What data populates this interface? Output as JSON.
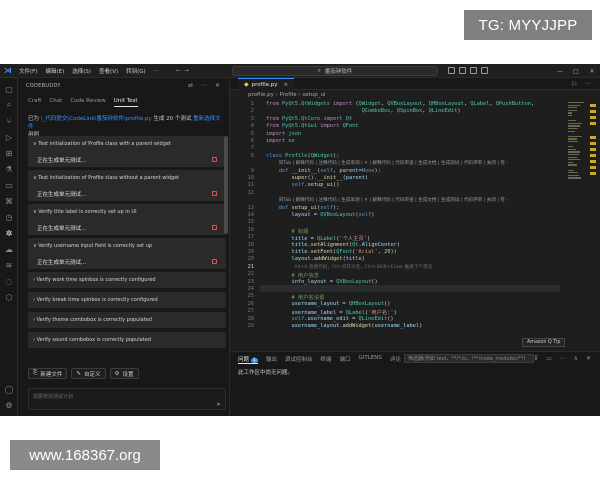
{
  "watermarks": {
    "top_right": "TG: MYYJJPP",
    "bottom_left": "www.168367.org"
  },
  "titlebar": {
    "logo": "⋊",
    "menu": [
      "文件(F)",
      "编辑(E)",
      "选择(S)",
      "查看(V)",
      "转到(G)",
      "…"
    ],
    "search_text": "番茄钟软件",
    "window_controls": [
      "—",
      "□",
      "✕"
    ]
  },
  "sidebar": {
    "header": "CODEBUDDY",
    "header_icons": "⇄ ⋯ ✕",
    "tabs": [
      "Craft",
      "Chat",
      "Code Review",
      "Unit Test"
    ],
    "info": {
      "prefix": "已为 ",
      "path": "\\_代码提交\\CodeLink\\番茄钟软件\\profile.py",
      "middle": " 生成 20 个测试 ",
      "retry": "重新选择文件",
      "suffix": "用例"
    },
    "tests": [
      {
        "title": "Test initialization of Profile class with a parent widget",
        "status": "正在生成单元测试..."
      },
      {
        "title": "Test initialization of Profile class without a parent widget",
        "status": "正在生成单元测试..."
      },
      {
        "title": "Verify title label is correctly set up in UI",
        "status": "正在生成单元测试..."
      },
      {
        "title": "Verify username input field is correctly set up",
        "status": "正在生成单元测试..."
      },
      {
        "title": "Verify work time spinbox is correctly configured"
      },
      {
        "title": "Verify break time spinbox is correctly configured"
      },
      {
        "title": "Verify theme combobox is correctly populated"
      },
      {
        "title": "Verify sound combobox is correctly populated"
      }
    ],
    "actions": [
      "新建文件",
      "自定义",
      "设置"
    ],
    "input_placeholder": "需要修改测试计划",
    "send_icon": "➤"
  },
  "editor": {
    "tab_label": "profile.py",
    "tab_close": "×",
    "tab_tools": "▷ ⋯",
    "breadcrumb": "profile.py  ›  Profile  ›  setup_ui",
    "tooltip": "Amazon Q Tip",
    "lines": [
      {
        "n": "1",
        "html": "<span class=\"kf\">from</span> <span class=\"cls\">PyQt5.QtWidgets</span> <span class=\"kf\">import</span> (<span class=\"cls\">QWidget</span>, <span class=\"cls\">QVBoxLayout</span>, <span class=\"cls\">QHBoxLayout</span>, <span class=\"cls\">QLabel</span>, <span class=\"cls\">QPushButton</span>,"
      },
      {
        "n": "2",
        "html": "                              <span class=\"cls\">QComboBox</span>, <span class=\"cls\">QSpinBox</span>, <span class=\"cls\">QLineEdit</span>)"
      },
      {
        "n": "3",
        "html": "<span class=\"kf\">from</span> <span class=\"cls\">PyQt5.QtCore</span> <span class=\"kf\">import</span> <span class=\"cls\">Qt</span>"
      },
      {
        "n": "4",
        "html": "<span class=\"kf\">from</span> <span class=\"cls\">PyQt5.QtGui</span> <span class=\"kf\">import</span> <span class=\"cls\">QFont</span>"
      },
      {
        "n": "5",
        "html": "<span class=\"kf\">import</span> <span class=\"cls\">json</span>"
      },
      {
        "n": "6",
        "html": "<span class=\"kf\">import</span> <span class=\"cls\">os</span>"
      },
      {
        "n": "7",
        "html": ""
      },
      {
        "n": "8",
        "html": "<span class=\"k\">class</span> <span class=\"cls\">Profile</span>(<span class=\"cls\">QWidget</span>):"
      },
      {
        "n": "",
        "html": "    <span class=\"codelens\">同Tab | 解释代码 | 注释代码 | 生成单测 | ✕ | 解释代码 | 代码审查 | 生成文档 | 生成测试 | 代码评审 | 关闭 | 有 -</span>"
      },
      {
        "n": "9",
        "html": "    <span class=\"k\">def</span> <span class=\"fn\">__init__</span>(<span class=\"self\">self</span>, <span class=\"var\">parent</span>=<span class=\"k\">None</span>):"
      },
      {
        "n": "10",
        "html": "        <span class=\"fn\">super</span>().<span class=\"fn\">__init__</span>(<span class=\"var\">parent</span>)"
      },
      {
        "n": "11",
        "html": "        <span class=\"self\">self</span>.<span class=\"fn\">setup_ui</span>()"
      },
      {
        "n": "12",
        "html": ""
      },
      {
        "n": "",
        "html": "    <span class=\"codelens\">同Tab | 解释代码 | 注释代码 | 生成单测 | ✕ | 解释代码 | 代码审查 | 生成文档 | 生成测试 | 代码评审 | 关闭 | 有 -</span>"
      },
      {
        "n": "13",
        "html": "    <span class=\"k\">def</span> <span class=\"fn\">setup_ui</span>(<span class=\"self\">self</span>):"
      },
      {
        "n": "14",
        "html": "        <span class=\"var\">layout</span> = <span class=\"cls\">QVBoxLayout</span>(<span class=\"self\">self</span>)"
      },
      {
        "n": "15",
        "html": ""
      },
      {
        "n": "16",
        "html": "        <span class=\"cm\"># 标题</span>"
      },
      {
        "n": "17",
        "html": "        <span class=\"var\">title</span> = <span class=\"cls\">QLabel</span>(<span class=\"str\">'个人主页'</span>)"
      },
      {
        "n": "18",
        "html": "        <span class=\"var\">title</span>.<span class=\"fn\">setAlignment</span>(<span class=\"cls\">Qt</span>.<span class=\"var\">AlignCenter</span>)"
      },
      {
        "n": "19",
        "html": "        <span class=\"var\">title</span>.<span class=\"fn\">setFont</span>(<span class=\"cls\">QFont</span>(<span class=\"str\">'Arial'</span>, <span class=\"num\">20</span>))"
      },
      {
        "n": "20",
        "html": "        <span class=\"var\">layout</span>.<span class=\"fn\">addWidget</span>(<span class=\"var\">title</span>)"
      },
      {
        "n": "21",
        "html": "        <span class=\"ghost\">  Alt+K 快捷代码，Ctrl 点开对话，Ctrl+Shift+Enter 触发下个建议</span>"
      },
      {
        "n": "22",
        "html": "        <span class=\"cm\"># 用户信息</span>"
      },
      {
        "n": "23",
        "html": "        <span class=\"var\">info_layout</span> = <span class=\"cls\">QVBoxLayout</span>()"
      },
      {
        "n": "24",
        "html": ""
      },
      {
        "n": "25",
        "html": "        <span class=\"cm\"># 用户名设置</span>"
      },
      {
        "n": "26",
        "html": "        <span class=\"var\">username_layout</span> = <span class=\"cls\">QHBoxLayout</span>()"
      },
      {
        "n": "27",
        "html": "        <span class=\"var\">username_label</span> = <span class=\"cls\">QLabel</span>(<span class=\"str\">'用户名:'</span>)"
      },
      {
        "n": "28",
        "html": "        <span class=\"self\">self</span>.<span class=\"var\">username_edit</span> = <span class=\"cls\">QLineEdit</span>()"
      },
      {
        "n": "29",
        "html": "        <span class=\"var\">username_layout</span>.<span class=\"fn\">addWidget</span>(<span class=\"var\">username_label</span>)"
      }
    ],
    "current_line": "21"
  },
  "panel": {
    "tabs": [
      {
        "label": "问题",
        "badge": "1"
      },
      {
        "label": "输出"
      },
      {
        "label": "调试控制台"
      },
      {
        "label": "终端"
      },
      {
        "label": "端口"
      },
      {
        "label": "GITLENS"
      },
      {
        "label": "评论"
      }
    ],
    "active_tab": "问题",
    "filter_placeholder": "筛选器(例如 text、**/*.ts、!**/node_modules/**)",
    "tools": "⊽ ▭ ⋯ ∧ ✕",
    "message": "此工作区中尚无问题。"
  },
  "activity_icons": [
    "files-icon",
    "search-icon",
    "source-control-icon",
    "run-debug-icon",
    "extensions-icon",
    "test-flask-icon",
    "remote-explorer-icon",
    "codebuddy-icon",
    "graph-icon",
    "docker-icon",
    "database-icon",
    "chat-icon",
    "hexagon-icon",
    "account-icon",
    "settings-gear-icon"
  ],
  "accent_colors": {
    "link": "#3794ff",
    "stop": "#e05252",
    "minimap_marker": "#c8a826"
  }
}
